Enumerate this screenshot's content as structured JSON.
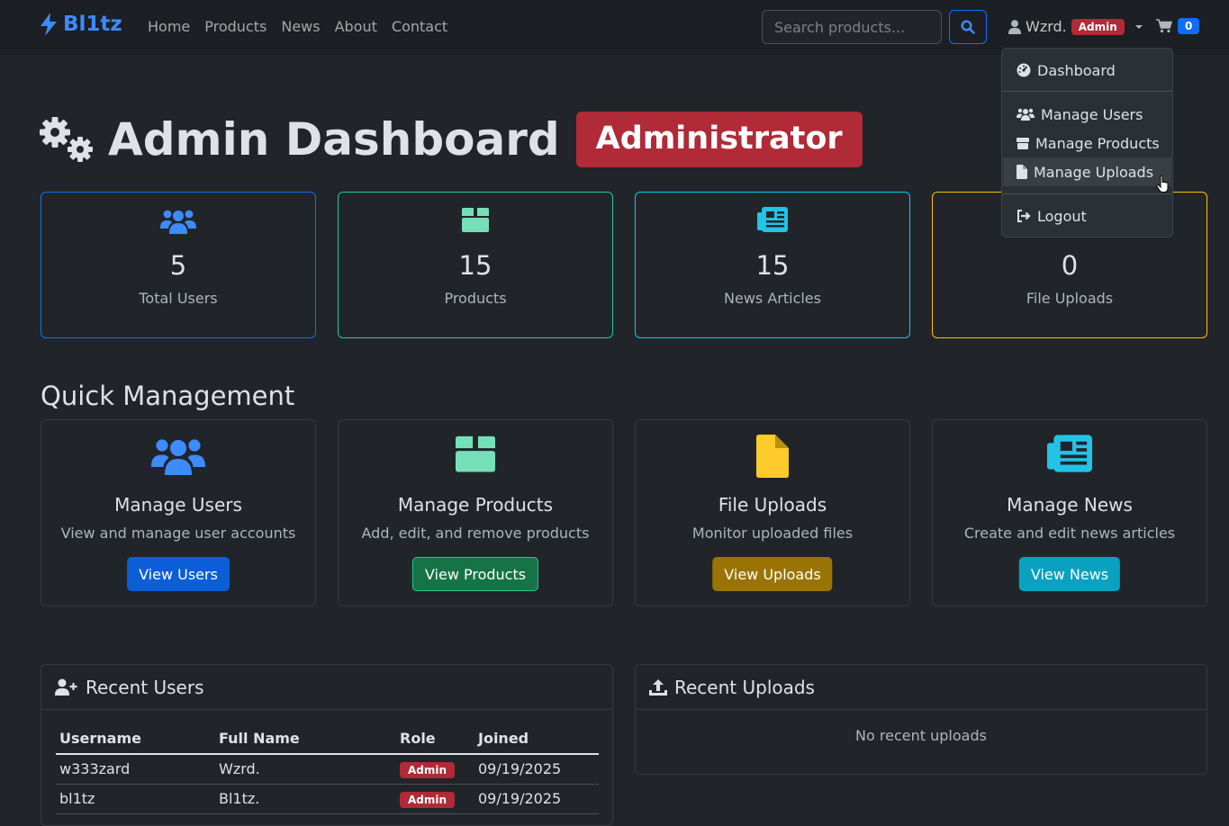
{
  "brand": "Bl1tz",
  "nav": [
    "Home",
    "Products",
    "News",
    "About",
    "Contact"
  ],
  "search": {
    "placeholder": "Search products..."
  },
  "user": {
    "name": "Wzrd.",
    "badge": "Admin"
  },
  "cart": {
    "count": "0"
  },
  "dropdown": {
    "dashboard": "Dashboard",
    "users": "Manage Users",
    "products": "Manage Products",
    "uploads": "Manage Uploads",
    "logout": "Logout"
  },
  "header": {
    "title": "Admin Dashboard",
    "role": "Administrator"
  },
  "stats": [
    {
      "value": "5",
      "label": "Total Users",
      "color": "#0d6efd"
    },
    {
      "value": "15",
      "label": "Products",
      "color": "#198754"
    },
    {
      "value": "15",
      "label": "News Articles",
      "color": "#0dcaf0"
    },
    {
      "value": "0",
      "label": "File Uploads",
      "color": "#ffc107"
    }
  ],
  "quick": {
    "title": "Quick Management",
    "cards": [
      {
        "title": "Manage Users",
        "desc": "View and manage user accounts",
        "button": "View Users"
      },
      {
        "title": "Manage Products",
        "desc": "Add, edit, and remove products",
        "button": "View Products"
      },
      {
        "title": "File Uploads",
        "desc": "Monitor uploaded files",
        "button": "View Uploads"
      },
      {
        "title": "Manage News",
        "desc": "Create and edit news articles",
        "button": "View News"
      }
    ]
  },
  "recent_users": {
    "title": "Recent Users",
    "headers": [
      "Username",
      "Full Name",
      "Role",
      "Joined"
    ],
    "rows": [
      {
        "username": "w333zard",
        "fullname": "Wzrd.",
        "role": "Admin",
        "joined": "09/19/2025"
      },
      {
        "username": "bl1tz",
        "fullname": "Bl1tz.",
        "role": "Admin",
        "joined": "09/19/2025"
      }
    ]
  },
  "recent_uploads": {
    "title": "Recent Uploads",
    "empty": "No recent uploads"
  }
}
